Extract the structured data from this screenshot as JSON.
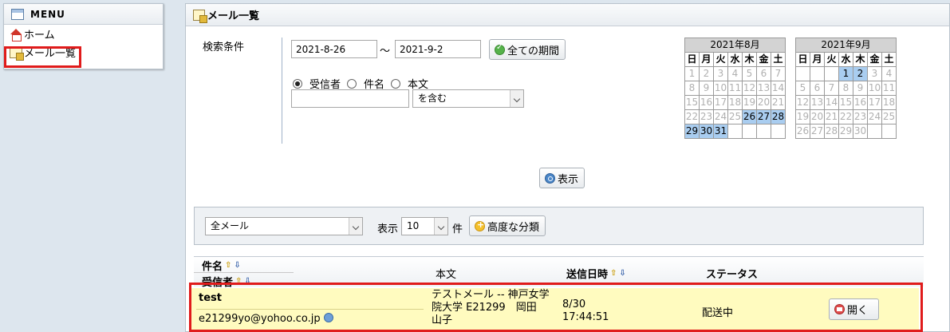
{
  "menu": {
    "title": "MENU",
    "items": [
      {
        "label": "ホーム",
        "icon": "home-icon"
      },
      {
        "label": "メール一覧",
        "icon": "mail-list-icon",
        "highlighted": true
      }
    ]
  },
  "page": {
    "title": "メール一覧"
  },
  "search": {
    "label": "検索条件",
    "date_from": "2021-8-26",
    "tilde": "～",
    "date_to": "2021-9-2",
    "all_period_label": "全ての期間",
    "radios": [
      {
        "label": "受信者",
        "checked": true
      },
      {
        "label": "件名",
        "checked": false
      },
      {
        "label": "本文",
        "checked": false
      }
    ],
    "keyword_value": "",
    "match_select": "を含む",
    "show_label": "表示"
  },
  "calendars": [
    {
      "title": "2021年8月",
      "dow": [
        "日",
        "月",
        "火",
        "水",
        "木",
        "金",
        "土"
      ],
      "weeks": [
        [
          {
            "d": "1",
            "s": "g"
          },
          {
            "d": "2",
            "s": "g"
          },
          {
            "d": "3",
            "s": "g"
          },
          {
            "d": "4",
            "s": "g"
          },
          {
            "d": "5",
            "s": "g"
          },
          {
            "d": "6",
            "s": "g"
          },
          {
            "d": "7",
            "s": "g"
          }
        ],
        [
          {
            "d": "8",
            "s": "g"
          },
          {
            "d": "9",
            "s": "g"
          },
          {
            "d": "10",
            "s": "g"
          },
          {
            "d": "11",
            "s": "g"
          },
          {
            "d": "12",
            "s": "g"
          },
          {
            "d": "13",
            "s": "g"
          },
          {
            "d": "14",
            "s": "g"
          }
        ],
        [
          {
            "d": "15",
            "s": "g"
          },
          {
            "d": "16",
            "s": "g"
          },
          {
            "d": "17",
            "s": "g"
          },
          {
            "d": "18",
            "s": "g"
          },
          {
            "d": "19",
            "s": "g"
          },
          {
            "d": "20",
            "s": "g"
          },
          {
            "d": "21",
            "s": "g"
          }
        ],
        [
          {
            "d": "22",
            "s": "g"
          },
          {
            "d": "23",
            "s": "g"
          },
          {
            "d": "24",
            "s": "g"
          },
          {
            "d": "25",
            "s": "g"
          },
          {
            "d": "26",
            "s": "sel"
          },
          {
            "d": "27",
            "s": "sel"
          },
          {
            "d": "28",
            "s": "sel"
          }
        ],
        [
          {
            "d": "29",
            "s": "sel"
          },
          {
            "d": "30",
            "s": "sel"
          },
          {
            "d": "31",
            "s": "sel"
          },
          {
            "d": "",
            "s": "e"
          },
          {
            "d": "",
            "s": "e"
          },
          {
            "d": "",
            "s": "e"
          },
          {
            "d": "",
            "s": "e"
          }
        ]
      ]
    },
    {
      "title": "2021年9月",
      "dow": [
        "日",
        "月",
        "火",
        "水",
        "木",
        "金",
        "土"
      ],
      "weeks": [
        [
          {
            "d": "",
            "s": "e"
          },
          {
            "d": "",
            "s": "e"
          },
          {
            "d": "",
            "s": "e"
          },
          {
            "d": "1",
            "s": "sel"
          },
          {
            "d": "2",
            "s": "sel"
          },
          {
            "d": "3",
            "s": "g"
          },
          {
            "d": "4",
            "s": "g"
          }
        ],
        [
          {
            "d": "5",
            "s": "g"
          },
          {
            "d": "6",
            "s": "g"
          },
          {
            "d": "7",
            "s": "g"
          },
          {
            "d": "8",
            "s": "g"
          },
          {
            "d": "9",
            "s": "g"
          },
          {
            "d": "10",
            "s": "g"
          },
          {
            "d": "11",
            "s": "g"
          }
        ],
        [
          {
            "d": "12",
            "s": "g"
          },
          {
            "d": "13",
            "s": "g"
          },
          {
            "d": "14",
            "s": "g"
          },
          {
            "d": "15",
            "s": "g"
          },
          {
            "d": "16",
            "s": "g"
          },
          {
            "d": "17",
            "s": "g"
          },
          {
            "d": "18",
            "s": "g"
          }
        ],
        [
          {
            "d": "19",
            "s": "g"
          },
          {
            "d": "20",
            "s": "g"
          },
          {
            "d": "21",
            "s": "g"
          },
          {
            "d": "22",
            "s": "g"
          },
          {
            "d": "23",
            "s": "g"
          },
          {
            "d": "24",
            "s": "g"
          },
          {
            "d": "25",
            "s": "g"
          }
        ],
        [
          {
            "d": "26",
            "s": "g"
          },
          {
            "d": "27",
            "s": "g"
          },
          {
            "d": "28",
            "s": "g"
          },
          {
            "d": "29",
            "s": "g"
          },
          {
            "d": "30",
            "s": "g"
          },
          {
            "d": "",
            "s": "e"
          },
          {
            "d": "",
            "s": "e"
          }
        ]
      ]
    }
  ],
  "filter": {
    "category_select": "全メール",
    "display_label": "表示",
    "count_select": "10",
    "count_unit": "件",
    "advanced_label": "高度な分類"
  },
  "table": {
    "headers": {
      "subject": "件名",
      "recipient": "受信者",
      "body": "本文",
      "sent_at": "送信日時",
      "status": "ステータス"
    },
    "rows": [
      {
        "subject": "test",
        "recipient": "e21299yo@yohoo.co.jp",
        "body_lines": [
          "テストメール -- 神戸女学",
          "院大学 E21299　岡田",
          "山子"
        ],
        "date": "8/30",
        "time": "17:44:51",
        "status": "配送中",
        "open_label": "開く"
      }
    ]
  },
  "colors": {
    "highlight_border": "#e01b1b",
    "row_background": "#fffbbf",
    "selected_day": "#a9cdf0"
  }
}
